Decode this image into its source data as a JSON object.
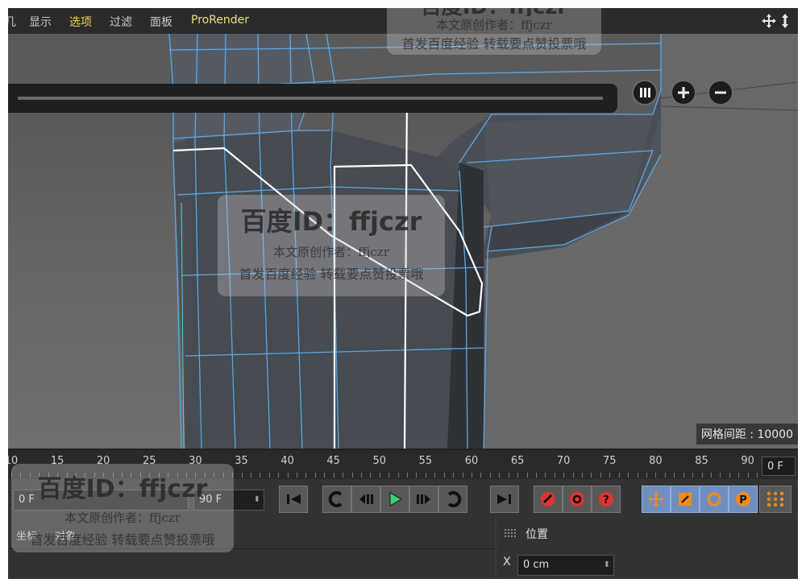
{
  "menu": {
    "partial": "几",
    "items": [
      "显示",
      "选项",
      "过滤",
      "面板",
      "ProRender"
    ],
    "active_item": "选项"
  },
  "viewport": {
    "grid_spacing_label": "网格间距 : 10000"
  },
  "timeline": {
    "ticks": [
      10,
      15,
      20,
      25,
      30,
      35,
      40,
      45,
      50,
      55,
      60,
      65,
      70,
      75,
      80,
      85,
      90
    ],
    "current_frame": "0 F",
    "start_frame": "0 F",
    "end_frame": "90 F"
  },
  "attributes": {
    "tabs": [
      "坐标",
      "对象"
    ],
    "section": "位置",
    "x_label": "X",
    "x_value": "0 cm"
  },
  "watermark": {
    "id_text": "百度ID：ffjczr",
    "line1": "本文原创作者：ffjczr",
    "line2": "首发百度经验 转载要点赞投票哦"
  },
  "colors": {
    "accent_active": "#f0d24a",
    "mesh_edge": "#5aa7e6",
    "selection": "#ffffff",
    "tool_highlight": "#6e8fbe"
  }
}
